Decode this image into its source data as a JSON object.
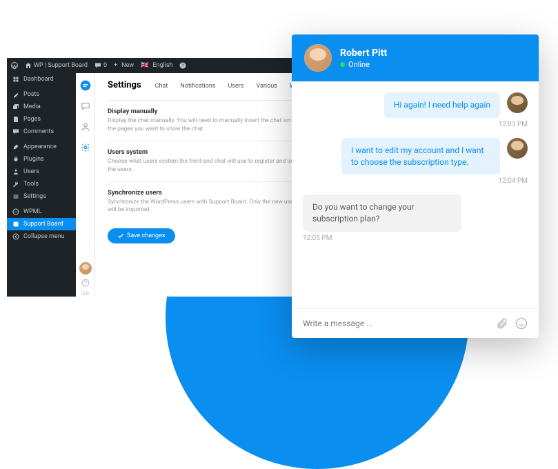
{
  "wp": {
    "topbar": {
      "site": "WP | Support Board",
      "comments": "0",
      "new": "New",
      "lang": "English"
    },
    "menu": {
      "dashboard": "Dashboard",
      "posts": "Posts",
      "media": "Media",
      "pages": "Pages",
      "comments": "Comments",
      "appearance": "Appearance",
      "plugins": "Plugins",
      "users": "Users",
      "tools": "Tools",
      "settings": "Settings",
      "wpml": "WPML",
      "support_board": "Support Board",
      "collapse": "Collapse menu"
    },
    "page": {
      "title": "Settings",
      "tabs": {
        "chat": "Chat",
        "notifications": "Notifications",
        "users": "Users",
        "various": "Various",
        "wordpress": "WordPress"
      }
    },
    "settings": [
      {
        "title": "Display manually",
        "desc": "Display the chat manually. You will need to manually insert the chat script to the pages you want to show the chat."
      },
      {
        "title": "Users system",
        "desc": "Choose what users system the front-end chat will use to register and login the users."
      },
      {
        "title": "Synchronize users",
        "desc": "Synchronize the WordPress users with Support Board. Only the new users will be imported."
      }
    ],
    "save": "Save changes",
    "version": "3.0"
  },
  "chat": {
    "header": {
      "name": "Robert Pitt",
      "status": "Online"
    },
    "messages": [
      {
        "side": "user",
        "text": "Hi again! I need help again",
        "time": "12:03 PM"
      },
      {
        "side": "user",
        "text": "I want to edit my account and I want to choose the subscription type.",
        "time": "12:04 PM"
      },
      {
        "side": "agent",
        "text": "Do you want to change your subscription plan?",
        "time": "12:05 PM"
      }
    ],
    "input_placeholder": "Write a message ..."
  }
}
